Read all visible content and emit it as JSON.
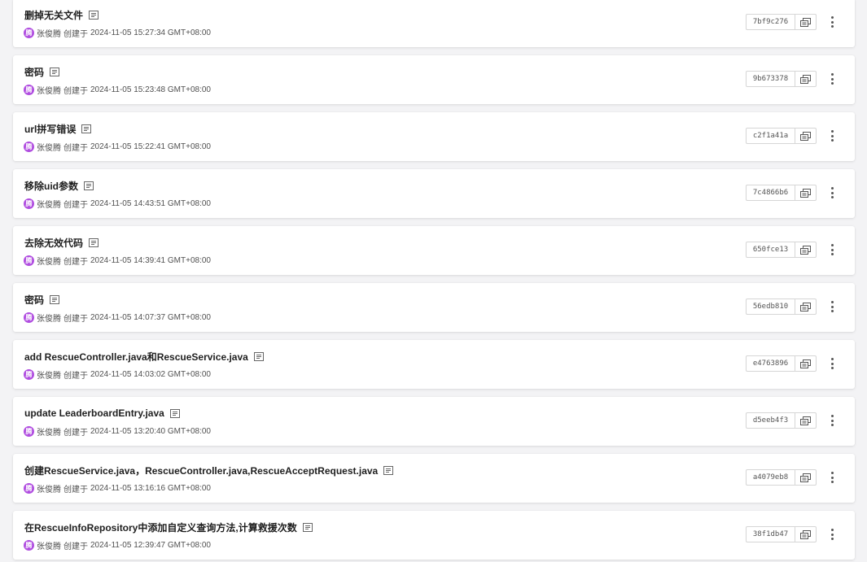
{
  "commits": [
    {
      "title": "删掉无关文件",
      "author": "张俊腾",
      "avatar_text": "腾",
      "created_label": "创建于",
      "timestamp": "2024-11-05 15:27:34 GMT+08:00",
      "hash": "7bf9c276"
    },
    {
      "title": "密码",
      "author": "张俊腾",
      "avatar_text": "腾",
      "created_label": "创建于",
      "timestamp": "2024-11-05 15:23:48 GMT+08:00",
      "hash": "9b673378"
    },
    {
      "title": "url拼写错误",
      "author": "张俊腾",
      "avatar_text": "腾",
      "created_label": "创建于",
      "timestamp": "2024-11-05 15:22:41 GMT+08:00",
      "hash": "c2f1a41a"
    },
    {
      "title": "移除uid参数",
      "author": "张俊腾",
      "avatar_text": "腾",
      "created_label": "创建于",
      "timestamp": "2024-11-05 14:43:51 GMT+08:00",
      "hash": "7c4866b6"
    },
    {
      "title": "去除无效代码",
      "author": "张俊腾",
      "avatar_text": "腾",
      "created_label": "创建于",
      "timestamp": "2024-11-05 14:39:41 GMT+08:00",
      "hash": "650fce13"
    },
    {
      "title": "密码",
      "author": "张俊腾",
      "avatar_text": "腾",
      "created_label": "创建于",
      "timestamp": "2024-11-05 14:07:37 GMT+08:00",
      "hash": "56edb810"
    },
    {
      "title": "add RescueController.java和RescueService.java",
      "author": "张俊腾",
      "avatar_text": "腾",
      "created_label": "创建于",
      "timestamp": "2024-11-05 14:03:02 GMT+08:00",
      "hash": "e4763896"
    },
    {
      "title": "update LeaderboardEntry.java",
      "author": "张俊腾",
      "avatar_text": "腾",
      "created_label": "创建于",
      "timestamp": "2024-11-05 13:20:40 GMT+08:00",
      "hash": "d5eeb4f3"
    },
    {
      "title": "创建RescueService.java，RescueController.java,RescueAcceptRequest.java",
      "author": "张俊腾",
      "avatar_text": "腾",
      "created_label": "创建于",
      "timestamp": "2024-11-05 13:16:16 GMT+08:00",
      "hash": "a4079eb8"
    },
    {
      "title": "在RescueInfoRepository中添加自定义查询方法,计算救援次数",
      "author": "张俊腾",
      "avatar_text": "腾",
      "created_label": "创建于",
      "timestamp": "2024-11-05 12:39:47 GMT+08:00",
      "hash": "38f1db47"
    }
  ],
  "colors": {
    "avatar": "#b04de0",
    "page_background": "#f3f3f5",
    "card_background": "#ffffff"
  },
  "icons": {
    "title_action": "document-icon",
    "copy": "copy-icon",
    "more": "more-vertical-icon"
  }
}
